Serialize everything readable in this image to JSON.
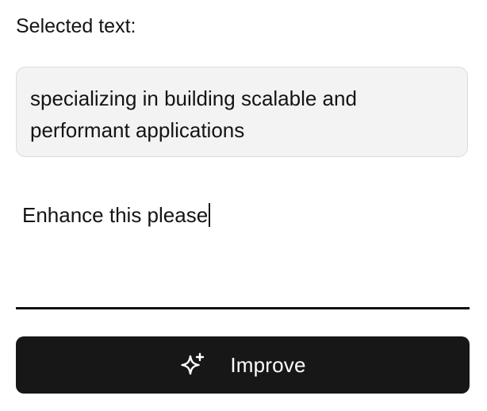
{
  "selected_section": {
    "label": "Selected text:",
    "text": "specializing in building scalable and performant applications"
  },
  "prompt_input": {
    "value": "Enhance this please",
    "caret": true
  },
  "improve_button": {
    "label": "Improve",
    "icon": "sparkle-icon"
  },
  "colors": {
    "button_background": "#171717",
    "selected_box_background": "#f3f3f3",
    "text": "#141414"
  }
}
